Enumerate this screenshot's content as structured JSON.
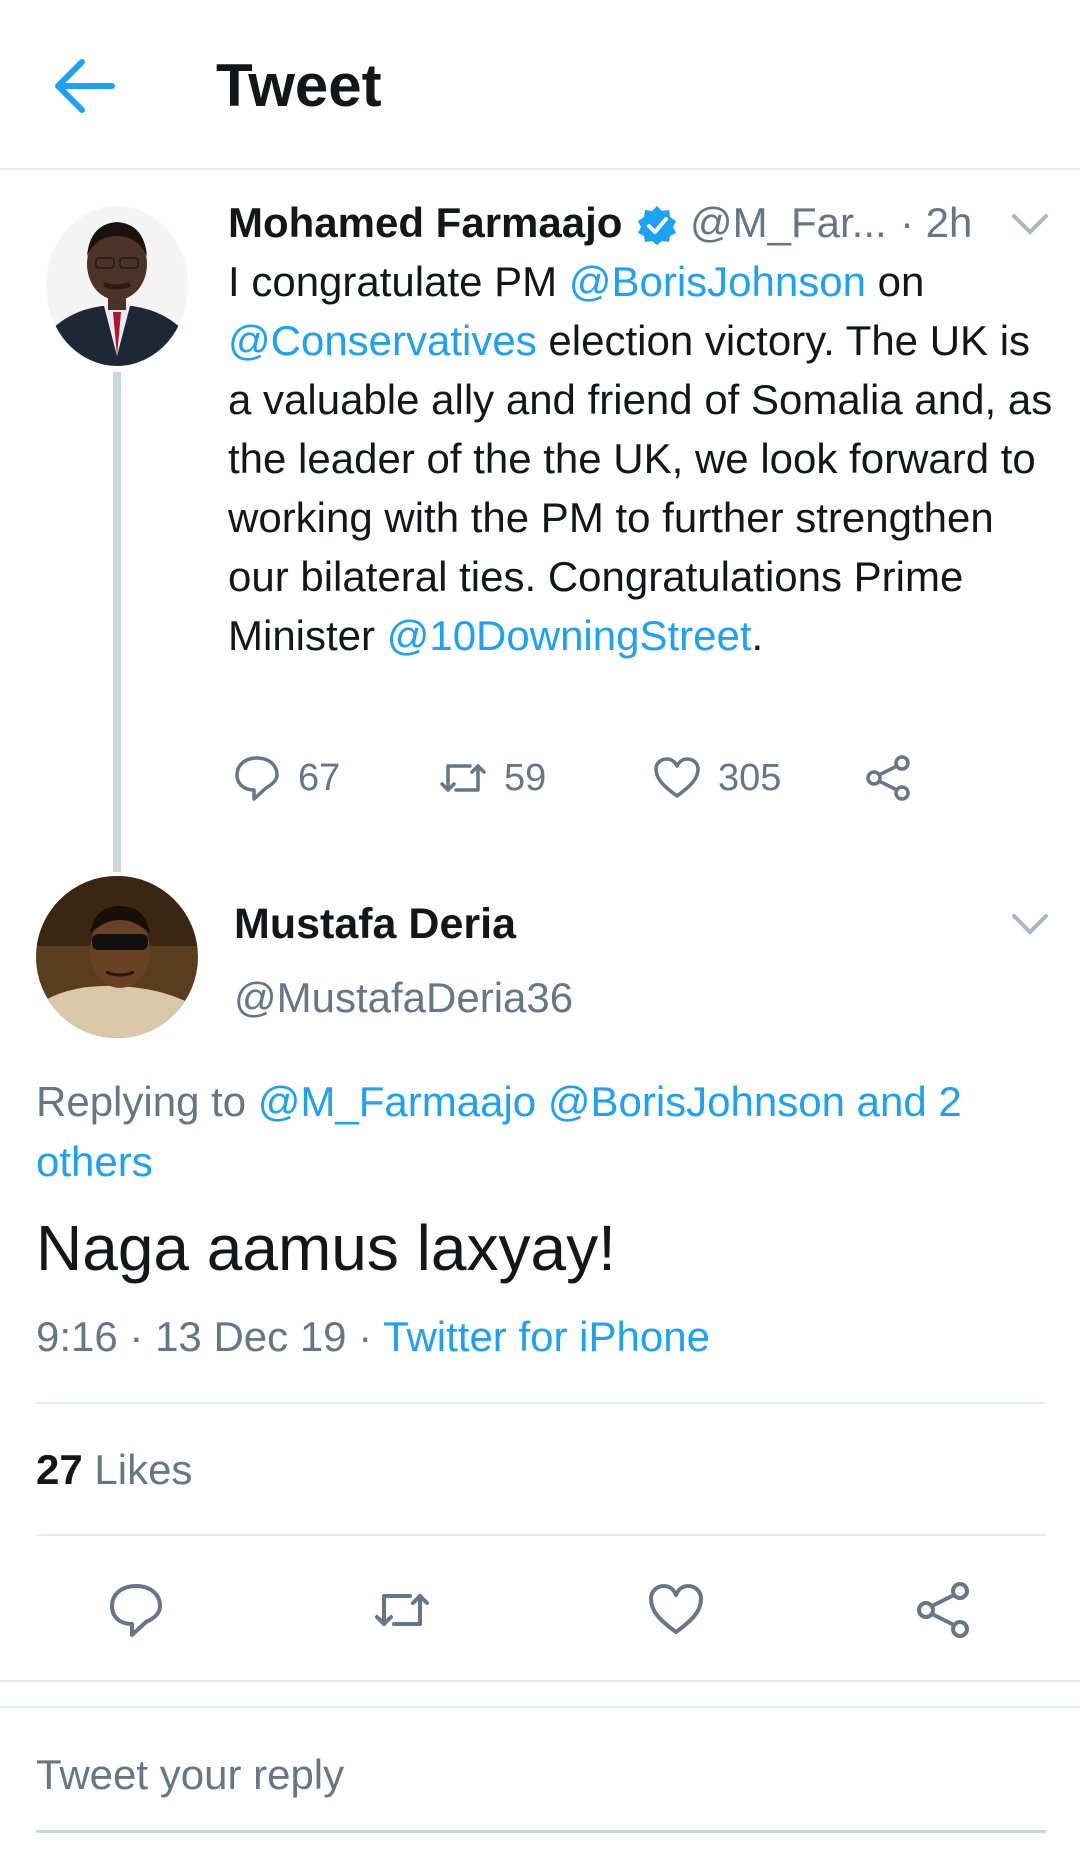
{
  "header": {
    "title": "Tweet",
    "back_icon": "arrow-left-icon"
  },
  "colors": {
    "accent": "#1da1f2",
    "text": "#14171a",
    "muted": "#657786",
    "divider": "#e6ecf0"
  },
  "parent_tweet": {
    "name": "Mohamed Farmaajo",
    "handle": "@M_Far...",
    "time": "· 2h",
    "verified_icon": "verified-badge-icon",
    "body": [
      {
        "text": "I congratulate PM ",
        "link": false
      },
      {
        "text": "@BorisJohnson",
        "link": true
      },
      {
        "text": " on ",
        "link": false
      },
      {
        "text": "@Conservatives",
        "link": true
      },
      {
        "text": " election victory. The UK is a valuable ally and friend of Somalia and, as the leader of the the UK, we look forward to working with the PM to further strengthen our bilateral ties. Congratulations Prime Minister ",
        "link": false
      },
      {
        "text": "@10DowningStreet",
        "link": true
      },
      {
        "text": ".",
        "link": false
      }
    ],
    "stats": {
      "replies": "67",
      "retweets": "59",
      "likes": "305"
    }
  },
  "focused_tweet": {
    "name": "Mustafa Deria",
    "handle": "@MustafaDeria36",
    "replying_prefix": "Replying to ",
    "replying_to": "@M_Farmaajo @BorisJohnson and 2 others",
    "body": "Naga aamus laxyay!",
    "time_date": "9:16 · 13 Dec 19 · ",
    "source": "Twitter for iPhone",
    "likes_count": "27",
    "likes_label": " Likes"
  },
  "reply_box": {
    "placeholder": "Tweet your reply"
  }
}
